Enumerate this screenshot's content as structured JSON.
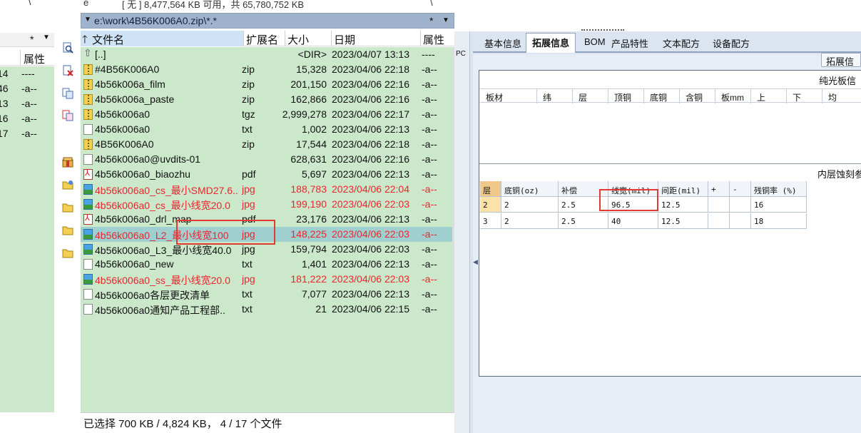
{
  "left_panel": {
    "topbar_text": "\\",
    "star": "*",
    "dropdown_glyph": "▼",
    "header_attr": "属性",
    "rows": [
      {
        "time": "14",
        "attr": "----"
      },
      {
        "time": "46",
        "attr": "-a--"
      },
      {
        "time": "13",
        "attr": "-a--"
      },
      {
        "time": "16",
        "attr": "-a--"
      },
      {
        "time": "17",
        "attr": "-a--"
      }
    ]
  },
  "toolbar": {
    "icons": [
      "search-file-icon",
      "delete-file-icon",
      "copy-file-icon",
      "move-file-icon",
      "package-icon",
      "new-folder-icon",
      "folder-icon",
      "folder-icon",
      "folder-icon"
    ]
  },
  "file_panel": {
    "drive": "e",
    "free_space": "[ 无 ]  8,477,564 KB 可用，共 65,780,752 KB",
    "backslash": "\\",
    "path": "e:\\work\\4B56K006A0.zip\\*.*",
    "path_star": "*",
    "dropdown_glyph": "▼",
    "columns": {
      "name": "文件名",
      "ext": "扩展名",
      "size": "大小",
      "date": "日期",
      "attr": "属性"
    },
    "files": [
      {
        "name": "[..]",
        "ext": "",
        "size": "<DIR>",
        "date": "2023/04/07 13:13",
        "attr": "----",
        "icon": "up",
        "red": false,
        "selected": false
      },
      {
        "name": "#4B56K006A0",
        "ext": "zip",
        "size": "15,328",
        "date": "2023/04/06 22:18",
        "attr": "-a--",
        "icon": "zip",
        "red": false,
        "selected": false
      },
      {
        "name": "4b56k006a_film",
        "ext": "zip",
        "size": "201,150",
        "date": "2023/04/06 22:16",
        "attr": "-a--",
        "icon": "zip",
        "red": false,
        "selected": false
      },
      {
        "name": "4b56k006a_paste",
        "ext": "zip",
        "size": "162,866",
        "date": "2023/04/06 22:16",
        "attr": "-a--",
        "icon": "zip",
        "red": false,
        "selected": false
      },
      {
        "name": "4b56k006a0",
        "ext": "tgz",
        "size": "2,999,278",
        "date": "2023/04/06 22:17",
        "attr": "-a--",
        "icon": "zip",
        "red": false,
        "selected": false
      },
      {
        "name": "4b56k006a0",
        "ext": "txt",
        "size": "1,002",
        "date": "2023/04/06 22:13",
        "attr": "-a--",
        "icon": "file",
        "red": false,
        "selected": false
      },
      {
        "name": "4B56K006A0",
        "ext": "zip",
        "size": "17,544",
        "date": "2023/04/06 22:18",
        "attr": "-a--",
        "icon": "zip",
        "red": false,
        "selected": false
      },
      {
        "name": "4b56k006a0@uvdits-01",
        "ext": "",
        "size": "628,631",
        "date": "2023/04/06 22:16",
        "attr": "-a--",
        "icon": "file",
        "red": false,
        "selected": false
      },
      {
        "name": "4b56k006a0_biaozhu",
        "ext": "pdf",
        "size": "5,697",
        "date": "2023/04/06 22:13",
        "attr": "-a--",
        "icon": "pdf",
        "red": false,
        "selected": false
      },
      {
        "name": "4b56k006a0_cs_最小SMD27.6..",
        "ext": "jpg",
        "size": "188,783",
        "date": "2023/04/06 22:04",
        "attr": "-a--",
        "icon": "jpg",
        "red": true,
        "selected": false
      },
      {
        "name": "4b56k006a0_cs_最小线宽20.0",
        "ext": "jpg",
        "size": "199,190",
        "date": "2023/04/06 22:03",
        "attr": "-a--",
        "icon": "jpg",
        "red": true,
        "selected": false
      },
      {
        "name": "4b56k006a0_drl_map",
        "ext": "pdf",
        "size": "23,176",
        "date": "2023/04/06 22:13",
        "attr": "-a--",
        "icon": "pdf",
        "red": false,
        "selected": false
      },
      {
        "name": "4b56k006a0_L2_最小线宽100",
        "ext": "jpg",
        "size": "148,225",
        "date": "2023/04/06 22:03",
        "attr": "-a--",
        "icon": "jpg",
        "red": true,
        "selected": true
      },
      {
        "name": "4b56k006a0_L3_最小线宽40.0",
        "ext": "jpg",
        "size": "159,794",
        "date": "2023/04/06 22:03",
        "attr": "-a--",
        "icon": "jpg",
        "red": false,
        "selected": false
      },
      {
        "name": "4b56k006a0_new",
        "ext": "txt",
        "size": "1,401",
        "date": "2023/04/06 22:13",
        "attr": "-a--",
        "icon": "file",
        "red": false,
        "selected": false
      },
      {
        "name": "4b56k006a0_ss_最小线宽20.0",
        "ext": "jpg",
        "size": "181,222",
        "date": "2023/04/06 22:03",
        "attr": "-a--",
        "icon": "jpg",
        "red": true,
        "selected": false
      },
      {
        "name": "4b56k006a0各层更改清单",
        "ext": "txt",
        "size": "7,077",
        "date": "2023/04/06 22:13",
        "attr": "-a--",
        "icon": "file",
        "red": false,
        "selected": false
      },
      {
        "name": "4b56k006a0通知产品工程部..",
        "ext": "txt",
        "size": "21",
        "date": "2023/04/06 22:15",
        "attr": "-a--",
        "icon": "file",
        "red": false,
        "selected": false
      }
    ],
    "status": "已选择 700 KB / 4,824 KB，  4 / 17 个文件"
  },
  "right_app": {
    "side_label": "PC",
    "tabs": [
      "基本信息",
      "拓展信息",
      "BOM",
      "产品特性",
      "文本配方",
      "设备配方"
    ],
    "active_tab": 1,
    "ext_button": "拓展信息",
    "section1_title": "纯光板信息",
    "table1_columns": [
      "板材",
      "纬",
      "层",
      "顶铜",
      "底铜",
      "含铜",
      "板mm",
      "上",
      "下",
      "均"
    ],
    "section2_title": "内层蚀刻参",
    "table2_columns": [
      "层",
      "底铜(oz)",
      "补偿",
      "线宽(mil)",
      "间距(mil)",
      "+",
      "-",
      "残铜率 (%)"
    ],
    "table2_rows": [
      [
        "2",
        "2",
        "2.5",
        "96.5",
        "12.5",
        "",
        "",
        "16"
      ],
      [
        "3",
        "2",
        "2.5",
        "40",
        "12.5",
        "",
        "",
        "18"
      ]
    ]
  },
  "accent": {
    "selected_row": "#9fd0cf",
    "list_bg": "#cbe8cb",
    "highlight_border": "#e23a30",
    "red_text": "#e8262f"
  }
}
